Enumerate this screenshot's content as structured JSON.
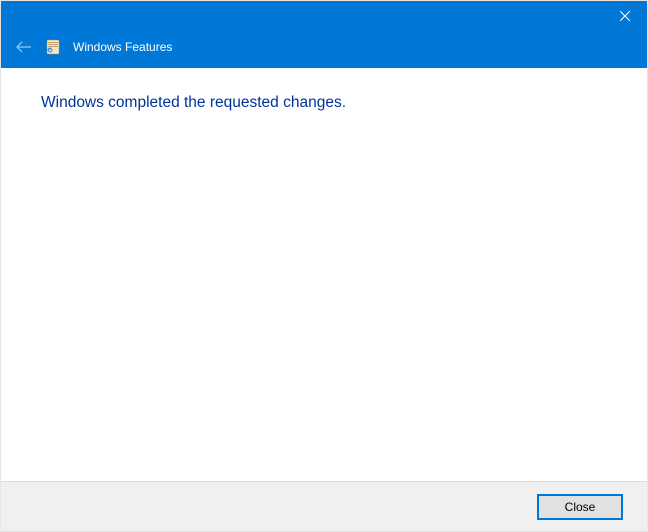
{
  "titlebar": {
    "title": "Windows Features"
  },
  "content": {
    "main_message": "Windows completed the requested changes."
  },
  "footer": {
    "close_label": "Close"
  }
}
